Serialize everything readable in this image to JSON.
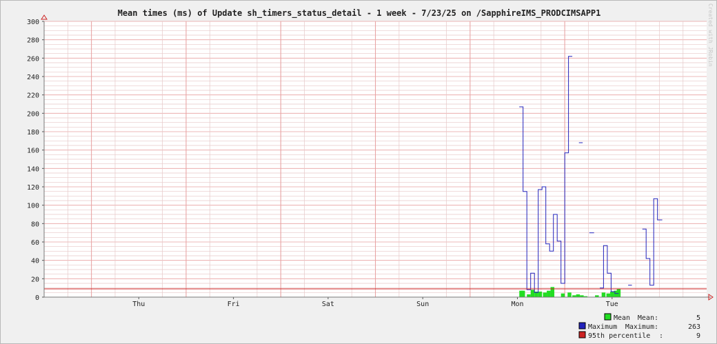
{
  "chart_data": {
    "type": "bar",
    "title": "Mean times (ms) of Update sh_timers_status_detail - 1 week - 7/23/25 on /SapphireIMS_PRODCIMSAPP1",
    "watermark": "Created with JRobin",
    "ylim": [
      0,
      300
    ],
    "y_ticks": [
      0,
      20,
      40,
      60,
      80,
      100,
      120,
      140,
      160,
      180,
      200,
      220,
      240,
      260,
      280,
      300
    ],
    "x_ticks": [
      "Thu",
      "Fri",
      "Sat",
      "Sun",
      "Mon",
      "Tue"
    ],
    "grid": true,
    "percentile95": 9,
    "colors": {
      "mean": "#22dd22",
      "maximum": "#2222bb",
      "percentile": "#cc2222",
      "major_grid": "#e8a0a0",
      "minor_grid": "#e6c8c8",
      "axis_arrow": "#cc2222"
    },
    "series": [
      {
        "name": "Mean",
        "style": "bars",
        "points": [
          [
            5.04,
            7
          ],
          [
            5.06,
            7
          ],
          [
            5.12,
            3
          ],
          [
            5.16,
            8
          ],
          [
            5.2,
            6
          ],
          [
            5.24,
            6
          ],
          [
            5.29,
            5
          ],
          [
            5.33,
            7
          ],
          [
            5.37,
            11
          ],
          [
            5.48,
            4
          ],
          [
            5.55,
            5
          ],
          [
            5.6,
            2
          ],
          [
            5.64,
            3
          ],
          [
            5.68,
            2
          ],
          [
            5.72,
            1
          ],
          [
            5.84,
            2
          ],
          [
            5.91,
            5
          ],
          [
            5.96,
            4
          ],
          [
            6.0,
            6
          ],
          [
            6.04,
            7
          ],
          [
            6.07,
            9
          ]
        ]
      },
      {
        "name": "Maximum",
        "style": "step",
        "segments": [
          [
            [
              5.02,
              207
            ],
            [
              5.06,
              207
            ],
            [
              5.06,
              115
            ],
            [
              5.1,
              115
            ],
            [
              5.1,
              8
            ],
            [
              5.14,
              8
            ],
            [
              5.14,
              26
            ],
            [
              5.18,
              26
            ],
            [
              5.18,
              5
            ],
            [
              5.22,
              5
            ],
            [
              5.22,
              117
            ],
            [
              5.26,
              117
            ],
            [
              5.26,
              120
            ],
            [
              5.3,
              120
            ],
            [
              5.3,
              58
            ],
            [
              5.34,
              58
            ],
            [
              5.34,
              50
            ],
            [
              5.38,
              50
            ],
            [
              5.38,
              90
            ],
            [
              5.42,
              90
            ],
            [
              5.42,
              61
            ],
            [
              5.46,
              61
            ],
            [
              5.46,
              15
            ],
            [
              5.5,
              15
            ],
            [
              5.5,
              157
            ],
            [
              5.54,
              157
            ],
            [
              5.54,
              262
            ],
            [
              5.58,
              262
            ]
          ],
          [
            [
              5.65,
              168
            ],
            [
              5.69,
              168
            ]
          ],
          [
            [
              5.76,
              70
            ],
            [
              5.81,
              70
            ]
          ],
          [
            [
              5.87,
              10
            ],
            [
              5.91,
              10
            ],
            [
              5.91,
              56
            ],
            [
              5.95,
              56
            ],
            [
              5.95,
              26
            ],
            [
              5.99,
              26
            ],
            [
              5.99,
              6
            ],
            [
              6.03,
              6
            ],
            [
              6.03,
              4
            ],
            [
              6.07,
              4
            ]
          ],
          [
            [
              6.17,
              13
            ],
            [
              6.21,
              13
            ]
          ],
          [
            [
              6.32,
              74
            ],
            [
              6.36,
              74
            ],
            [
              6.36,
              42
            ],
            [
              6.4,
              42
            ],
            [
              6.4,
              13
            ],
            [
              6.44,
              13
            ],
            [
              6.44,
              107
            ],
            [
              6.48,
              107
            ],
            [
              6.48,
              84
            ],
            [
              6.53,
              84
            ]
          ]
        ]
      }
    ],
    "legend": [
      {
        "label": "Mean",
        "stat_label": "Mean:",
        "stat_value": "5",
        "color_key": "mean"
      },
      {
        "label": "Maximum",
        "stat_label": "Maximum:",
        "stat_value": "263",
        "color_key": "maximum"
      },
      {
        "label": "95th percentile",
        "stat_label": ":",
        "stat_value": "9",
        "color_key": "percentile"
      }
    ]
  }
}
